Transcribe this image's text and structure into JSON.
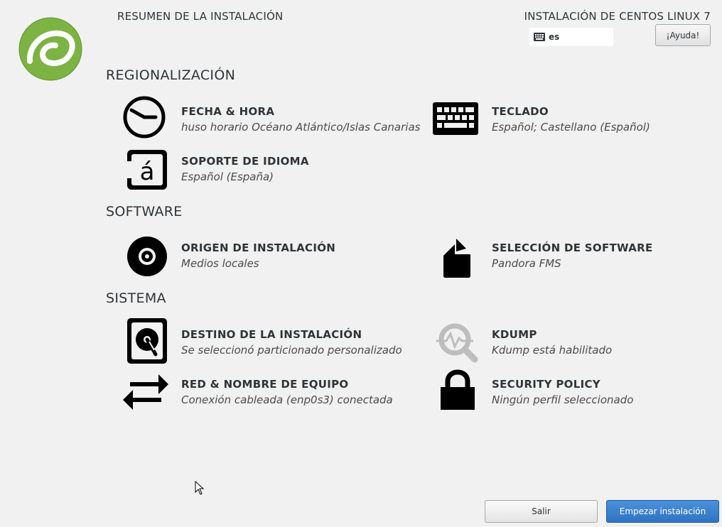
{
  "header": {
    "summary_title": "RESUMEN DE LA INSTALACIÓN",
    "product_title": "INSTALACIÓN DE CENTOS LINUX 7",
    "keyboard_layout": "es",
    "help_label": "¡Ayuda!"
  },
  "colors": {
    "accent": "#2f74c4",
    "logo_green": "#7cb342",
    "background": "#f1f1f1"
  },
  "sections": {
    "localization": "REGIONALIZACIÓN",
    "software": "SOFTWARE",
    "system": "SISTEMA"
  },
  "spokes": {
    "datetime": {
      "title": "FECHA & HORA",
      "status": "huso horario Océano Atlántico/Islas Canarias",
      "icon": "clock-icon"
    },
    "keyboard": {
      "title": "TECLADO",
      "status": "Español; Castellano (Español)",
      "icon": "keyboard-icon"
    },
    "language": {
      "title": "SOPORTE DE IDIOMA",
      "status": "Español (España)",
      "icon": "language-icon"
    },
    "source": {
      "title": "ORIGEN DE INSTALACIÓN",
      "status": "Medios locales",
      "icon": "disc-icon"
    },
    "software": {
      "title": "SELECCIÓN DE SOFTWARE",
      "status": "Pandora FMS",
      "icon": "package-icon"
    },
    "destination": {
      "title": "DESTINO DE LA INSTALACIÓN",
      "status": "Se seleccionó particionado personalizado",
      "icon": "harddisk-icon"
    },
    "kdump": {
      "title": "KDUMP",
      "status": "Kdump está habilitado",
      "icon": "kdump-icon"
    },
    "network": {
      "title": "RED & NOMBRE DE EQUIPO",
      "status": "Conexión cableada (enp0s3) conectada",
      "icon": "network-icon"
    },
    "security": {
      "title": "SECURITY POLICY",
      "status": "Ningún perfil seleccionado",
      "icon": "lock-icon"
    }
  },
  "footer": {
    "quit_label": "Salir",
    "begin_label": "Empezar instalación"
  }
}
